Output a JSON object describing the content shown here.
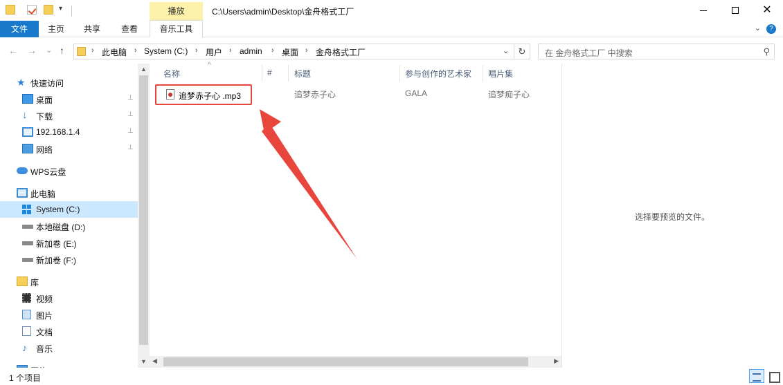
{
  "titlebar": {
    "contextual_tab": "播放",
    "path": "C:\\Users\\admin\\Desktop\\金舟格式工厂",
    "close": "✕"
  },
  "ribbon": {
    "tabs": [
      "文件",
      "主页",
      "共享",
      "查看",
      "音乐工具"
    ],
    "expand": "⌄",
    "help": "?"
  },
  "navbar": {
    "back": "←",
    "forward": "→",
    "recent": "⌄",
    "up": "↑",
    "breadcrumbs": [
      "此电脑",
      "System (C:)",
      "用户",
      "admin",
      "桌面",
      "金舟格式工厂"
    ],
    "separator": "›",
    "dropdown": "⌄",
    "refresh": "↻",
    "search_placeholder": "在 金舟格式工厂 中搜索"
  },
  "sidebar": {
    "items": [
      {
        "label": "快速访问",
        "icon": "star-icon"
      },
      {
        "label": "桌面",
        "icon": "desktop-icon",
        "pinned": true
      },
      {
        "label": "下载",
        "icon": "download-icon",
        "pinned": true
      },
      {
        "label": "192.168.1.4",
        "icon": "monitor-icon",
        "pinned": true
      },
      {
        "label": "网络",
        "icon": "network-icon",
        "pinned": true
      },
      {
        "label": "WPS云盘",
        "icon": "cloud-icon"
      },
      {
        "label": "此电脑",
        "icon": "computer-icon"
      },
      {
        "label": "System (C:)",
        "icon": "windows-drive-icon",
        "selected": true
      },
      {
        "label": "本地磁盘 (D:)",
        "icon": "drive-icon"
      },
      {
        "label": "新加卷 (E:)",
        "icon": "drive-icon"
      },
      {
        "label": "新加卷 (F:)",
        "icon": "drive-icon"
      },
      {
        "label": "库",
        "icon": "library-icon"
      },
      {
        "label": "视频",
        "icon": "video-icon"
      },
      {
        "label": "图片",
        "icon": "picture-icon"
      },
      {
        "label": "文档",
        "icon": "document-icon"
      },
      {
        "label": "音乐",
        "icon": "music-icon"
      },
      {
        "label": "网络",
        "icon": "network-icon"
      }
    ],
    "pin_glyph": "📌"
  },
  "columns": [
    "名称",
    "#",
    "标题",
    "参与创作的艺术家",
    "唱片集"
  ],
  "sort_arrow": "^",
  "files": [
    {
      "name": "追梦赤子心 .mp3",
      "number": "",
      "title": "追梦赤子心",
      "artist": "GALA",
      "album": "追梦痴子心"
    }
  ],
  "preview": {
    "empty_text": "选择要预览的文件。"
  },
  "statusbar": {
    "count": "1 个项目"
  },
  "colors": {
    "accent": "#1979ca",
    "selection": "#cce8ff",
    "highlight_box": "#e8453c",
    "contextual_tab": "#fdf0a8"
  }
}
